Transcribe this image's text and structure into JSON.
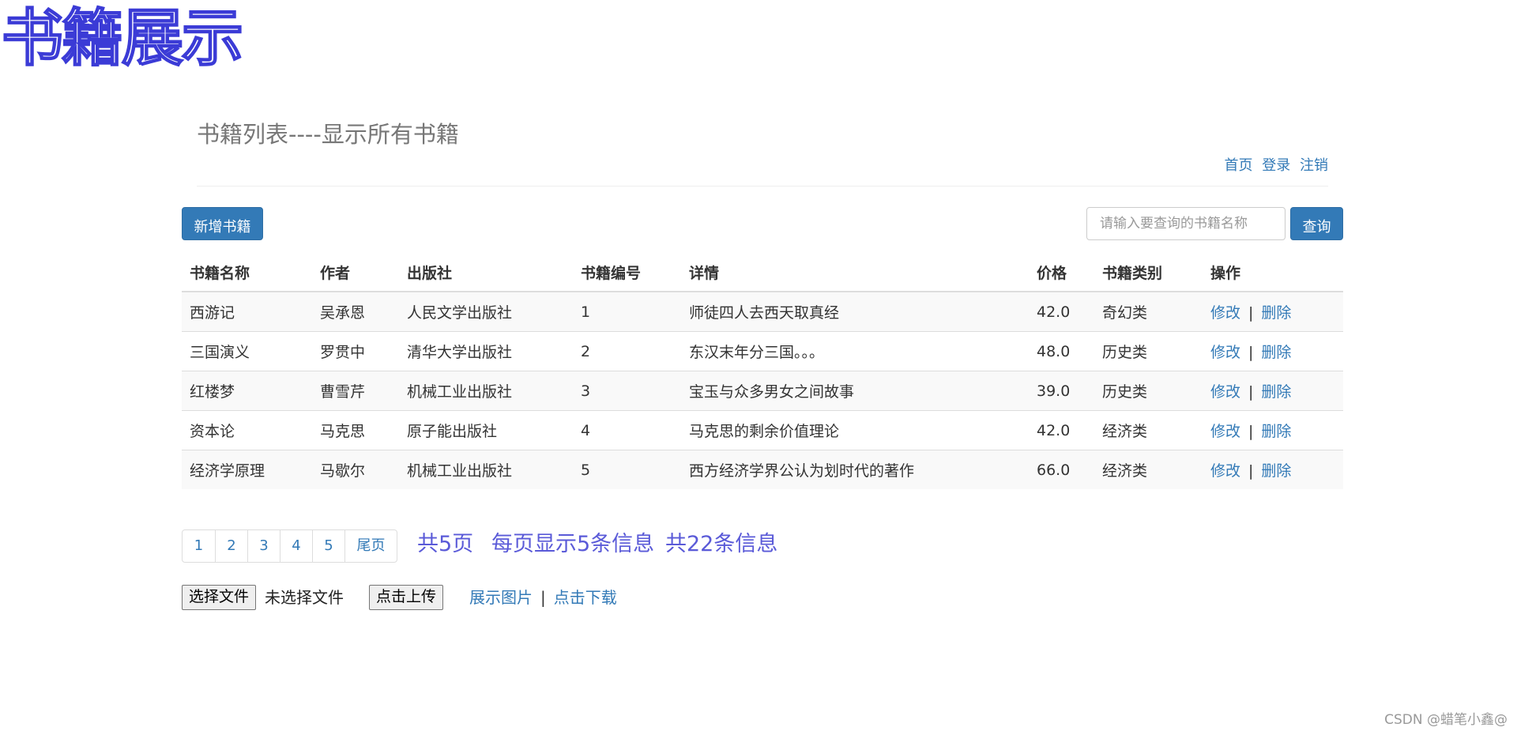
{
  "logo_text": "书籍展示",
  "page_title": "书籍列表----显示所有书籍",
  "top_nav": {
    "home": "首页",
    "login": "登录",
    "logout": "注销"
  },
  "toolbar": {
    "add_label": "新增书籍",
    "search_placeholder": "请输入要查询的书籍名称",
    "query_label": "查询"
  },
  "table": {
    "headers": [
      "书籍名称",
      "作者",
      "出版社",
      "书籍编号",
      "详情",
      "价格",
      "书籍类别",
      "操作"
    ],
    "edit_label": "修改",
    "delete_label": "删除",
    "separator": "|",
    "rows": [
      {
        "name": "西游记",
        "author": "吴承恩",
        "publisher": "人民文学出版社",
        "id": "1",
        "detail": "师徒四人去西天取真经",
        "price": "42.0",
        "category": "奇幻类"
      },
      {
        "name": "三国演义",
        "author": "罗贯中",
        "publisher": "清华大学出版社",
        "id": "2",
        "detail": "东汉末年分三国。。。",
        "price": "48.0",
        "category": "历史类"
      },
      {
        "name": "红楼梦",
        "author": "曹雪芹",
        "publisher": "机械工业出版社",
        "id": "3",
        "detail": "宝玉与众多男女之间故事",
        "price": "39.0",
        "category": "历史类"
      },
      {
        "name": "资本论",
        "author": "马克思",
        "publisher": "原子能出版社",
        "id": "4",
        "detail": "马克思的剩余价值理论",
        "price": "42.0",
        "category": "经济类"
      },
      {
        "name": "经济学原理",
        "author": "马歇尔",
        "publisher": "机械工业出版社",
        "id": "5",
        "detail": "西方经济学界公认为划时代的著作",
        "price": "66.0",
        "category": "经济类"
      }
    ]
  },
  "pagination": {
    "pages": [
      "1",
      "2",
      "3",
      "4",
      "5"
    ],
    "last_label": "尾页",
    "total_pages": "共5页",
    "per_page": "每页显示5条信息",
    "total_items": "共22条信息"
  },
  "upload": {
    "choose_label": "选择文件",
    "no_file": "未选择文件",
    "upload_label": "点击上传",
    "show_images": "展示图片",
    "separator": "|",
    "download": "点击下载"
  },
  "watermark": "CSDN @蜡笔小鑫@",
  "colors": {
    "primary": "#337ab7",
    "link": "#337ab7",
    "page_info": "#5a5ad8",
    "logo_outline": "#3b3bd6"
  }
}
